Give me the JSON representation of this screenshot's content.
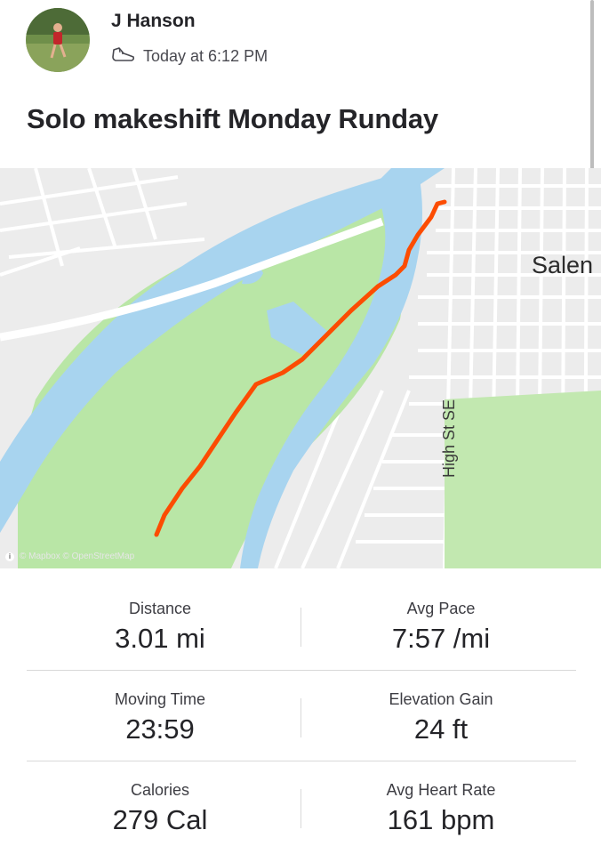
{
  "athlete": {
    "name": "J Hanson",
    "timestamp": "Today at 6:12 PM"
  },
  "activity": {
    "title": "Solo makeshift Monday Runday",
    "type_icon": "shoe-icon"
  },
  "map": {
    "city_label": "Salen",
    "street_label": "High St SE",
    "attribution": "© Mapbox © OpenStreetMap",
    "route_color": "#fc4c02",
    "water_color": "#a8d4ef",
    "park_color": "#b9e6a6"
  },
  "stats": [
    {
      "label": "Distance",
      "value": "3.01 mi"
    },
    {
      "label": "Avg Pace",
      "value": "7:57 /mi"
    },
    {
      "label": "Moving Time",
      "value": "23:59"
    },
    {
      "label": "Elevation Gain",
      "value": "24 ft"
    },
    {
      "label": "Calories",
      "value": "279 Cal"
    },
    {
      "label": "Avg Heart Rate",
      "value": "161 bpm"
    }
  ]
}
